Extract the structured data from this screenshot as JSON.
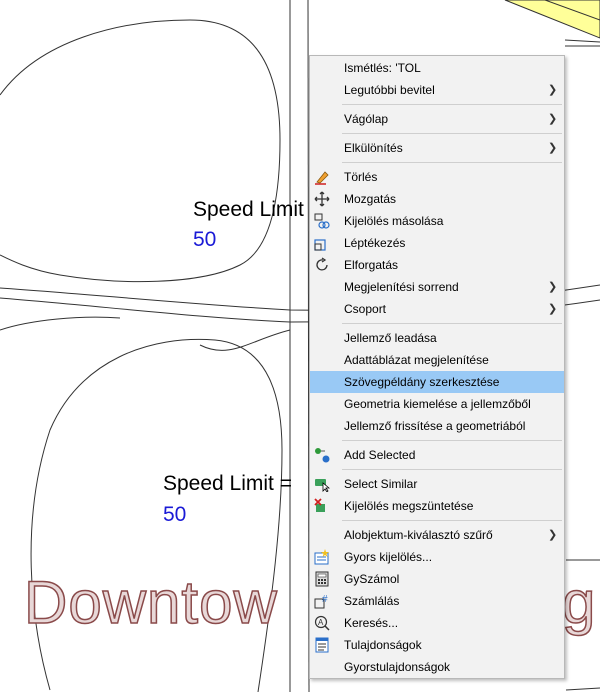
{
  "map": {
    "labels": [
      {
        "speed": "Speed Limit",
        "value": "50"
      },
      {
        "speed": "Speed Limit =",
        "value": "50"
      }
    ],
    "watermark": {
      "left": "Downtow",
      "right": "g"
    },
    "colors": {
      "road_line": "#333333",
      "parcel_fill": "#ffff99",
      "value_text": "#1a1ad6"
    }
  },
  "context_menu": {
    "highlight_color": "#99c9f5",
    "items": [
      {
        "label": "Ismétlés: 'TOL",
        "submenu": false,
        "icon": ""
      },
      {
        "label": "Legutóbbi bevitel",
        "submenu": true,
        "icon": ""
      },
      {
        "label": "Vágólap",
        "submenu": true,
        "icon": ""
      },
      {
        "label": "Elkülönítés",
        "submenu": true,
        "icon": ""
      },
      {
        "label": "Törlés",
        "submenu": false,
        "icon": "eraser-icon"
      },
      {
        "label": "Mozgatás",
        "submenu": false,
        "icon": "move-icon"
      },
      {
        "label": "Kijelölés másolása",
        "submenu": false,
        "icon": "copy-selection-icon"
      },
      {
        "label": "Léptékezés",
        "submenu": false,
        "icon": "scale-icon"
      },
      {
        "label": "Elforgatás",
        "submenu": false,
        "icon": "rotate-icon"
      },
      {
        "label": "Megjelenítési sorrend",
        "submenu": true,
        "icon": ""
      },
      {
        "label": "Csoport",
        "submenu": true,
        "icon": ""
      },
      {
        "label": "Jellemző leadása",
        "submenu": false,
        "icon": ""
      },
      {
        "label": "Adattáblázat megjelenítése",
        "submenu": false,
        "icon": ""
      },
      {
        "label": "Szövegpéldány szerkesztése",
        "submenu": false,
        "icon": "",
        "highlighted": true
      },
      {
        "label": "Geometria kiemelése a jellemzőből",
        "submenu": false,
        "icon": ""
      },
      {
        "label": "Jellemző frissítése a geometriából",
        "submenu": false,
        "icon": ""
      },
      {
        "label": "Add Selected",
        "submenu": false,
        "icon": "add-selected-icon"
      },
      {
        "label": "Select Similar",
        "submenu": false,
        "icon": "select-similar-icon"
      },
      {
        "label": "Kijelölés megszüntetése",
        "submenu": false,
        "icon": "deselect-icon"
      },
      {
        "label": "Alobjektum-kiválasztó szűrő",
        "submenu": true,
        "icon": ""
      },
      {
        "label": "Gyors kijelölés...",
        "submenu": false,
        "icon": "quick-select-icon"
      },
      {
        "label": "GySzámol",
        "submenu": false,
        "icon": "calculator-icon"
      },
      {
        "label": "Számlálás",
        "submenu": false,
        "icon": "count-icon"
      },
      {
        "label": "Keresés...",
        "submenu": false,
        "icon": "find-icon"
      },
      {
        "label": "Tulajdonságok",
        "submenu": false,
        "icon": "properties-icon"
      },
      {
        "label": "Gyorstulajdonságok",
        "submenu": false,
        "icon": ""
      }
    ]
  }
}
